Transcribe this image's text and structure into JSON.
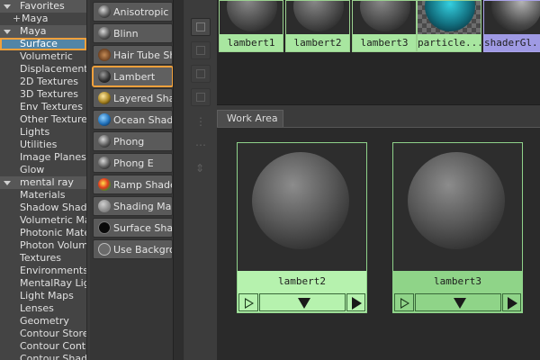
{
  "tree": {
    "favorites": {
      "label": "Favorites",
      "children": [
        {
          "label": "Maya",
          "expandable": true
        }
      ]
    },
    "maya": {
      "label": "Maya",
      "children": [
        "Surface",
        "Volumetric",
        "Displacement",
        "2D Textures",
        "3D Textures",
        "Env Textures",
        "Other Textures",
        "Lights",
        "Utilities",
        "Image Planes",
        "Glow"
      ],
      "selected": "Surface"
    },
    "mental_ray": {
      "label": "mental ray",
      "children": [
        "Materials",
        "Shadow Shad...",
        "Volumetric Ma...",
        "Photonic Mate...",
        "Photon Volum...",
        "Textures",
        "Environments",
        "MentalRay Lig...",
        "Light Maps",
        "Lenses",
        "Geometry",
        "Contour Store",
        "Contour Cont...",
        "Contour Shade..."
      ]
    }
  },
  "shaders": {
    "items": [
      {
        "label": "Anisotropic",
        "icon": "sphere-icon"
      },
      {
        "label": "Blinn",
        "icon": "sphere-icon"
      },
      {
        "label": "Hair Tube Sha",
        "icon": "hair-tube-icon"
      },
      {
        "label": "Lambert",
        "icon": "sphere-icon"
      },
      {
        "label": "Layered Shade",
        "icon": "layered-shader-icon"
      },
      {
        "label": "Ocean Shader",
        "icon": "ocean-shader-icon"
      },
      {
        "label": "Phong",
        "icon": "sphere-icon"
      },
      {
        "label": "Phong E",
        "icon": "sphere-icon"
      },
      {
        "label": "Ramp Shader",
        "icon": "ramp-shader-icon"
      },
      {
        "label": "Shading Map",
        "icon": "shading-map-icon"
      },
      {
        "label": "Surface Shade",
        "icon": "surface-shader-icon"
      },
      {
        "label": "Use Backgroun",
        "icon": "use-background-icon"
      }
    ],
    "selected": "Lambert"
  },
  "swatches": [
    {
      "name": "lambert1",
      "type": "lambert"
    },
    {
      "name": "lambert2",
      "type": "lambert"
    },
    {
      "name": "lambert3",
      "type": "lambert"
    },
    {
      "name": "particle...",
      "type": "particle"
    },
    {
      "name": "shaderGl...",
      "type": "shaderGlow"
    }
  ],
  "work_area": {
    "tab_label": "Work Area",
    "nodes": [
      {
        "name": "lambert2",
        "highlight": "light"
      },
      {
        "name": "lambert3",
        "highlight": "mid"
      }
    ]
  },
  "colors": {
    "selection_outline": "#f0a03c",
    "tree_selected_bg": "#5285a6",
    "node_green_light": "#b6f2ae",
    "node_green_mid": "#8fd488",
    "swatch_name_purple": "#9f9ae4"
  }
}
